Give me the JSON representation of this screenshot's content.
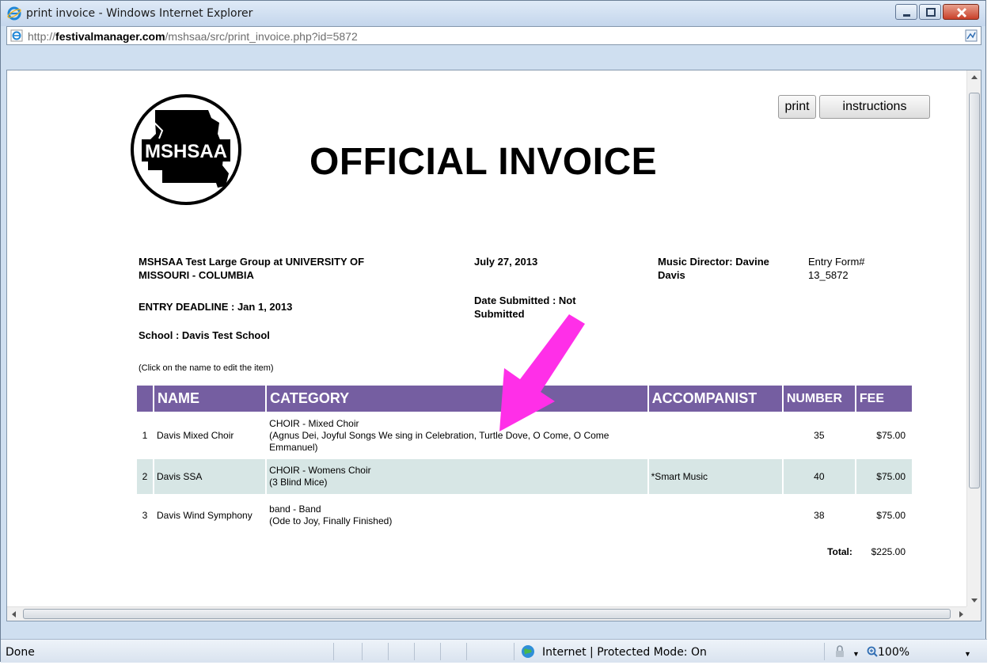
{
  "window": {
    "title": "print invoice - Windows Internet Explorer",
    "url_prefix": "http://",
    "url_domain": "festivalmanager.com",
    "url_path": "/mshsaa/src/print_invoice.php?id=5872"
  },
  "page": {
    "logo_text": "MSHSAA",
    "heading": "OFFICIAL INVOICE",
    "buttons": {
      "print": "print",
      "instructions": "instructions"
    },
    "event_line1": "MSHSAA Test Large Group at UNIVERSITY OF",
    "event_line2": "MISSOURI - COLUMBIA",
    "entry_deadline": "ENTRY DEADLINE : Jan 1, 2013",
    "school": "School : Davis Test School",
    "event_date": "July 27, 2013",
    "date_submitted_line1": "Date Submitted : Not",
    "date_submitted_line2": "Submitted",
    "director_line1": "Music Director: Davine",
    "director_line2": "Davis",
    "entry_form_label": "Entry Form#",
    "entry_form_number": "13_5872",
    "hint": "(Click on the name to edit the item)"
  },
  "table": {
    "headers": [
      "NAME",
      "CATEGORY",
      "ACCOMPANIST",
      "NUMBER",
      "FEE"
    ],
    "rows": [
      {
        "index": "1",
        "name": "Davis Mixed Choir",
        "category": "CHOIR - Mixed Choir",
        "pieces": "(Agnus Dei, Joyful Songs We sing in Celebration, Turtle Dove, O Come, O Come Emmanuel)",
        "accompanist": "",
        "number": "35",
        "fee": "$75.00"
      },
      {
        "index": "2",
        "name": "Davis SSA",
        "category": "CHOIR - Womens Choir",
        "pieces": "(3 Blind Mice)",
        "accompanist": "*Smart Music",
        "number": "40",
        "fee": "$75.00"
      },
      {
        "index": "3",
        "name": "Davis Wind Symphony",
        "category": "band - Band",
        "pieces": "(Ode to Joy, Finally Finished)",
        "accompanist": "",
        "number": "38",
        "fee": "$75.00"
      }
    ],
    "total_label": "Total:",
    "total_value": "$225.00"
  },
  "status": {
    "text": "Done",
    "zone": "Internet | Protected Mode: On",
    "zoom": "100%"
  },
  "colors": {
    "header_purple": "#755ea1",
    "alt_row": "#d7e6e5",
    "arrow_magenta": "#ff2fe8"
  },
  "icons": [
    "ie-icon",
    "compat-view-icon",
    "globe-icon",
    "security-icon",
    "zoom-icon"
  ]
}
